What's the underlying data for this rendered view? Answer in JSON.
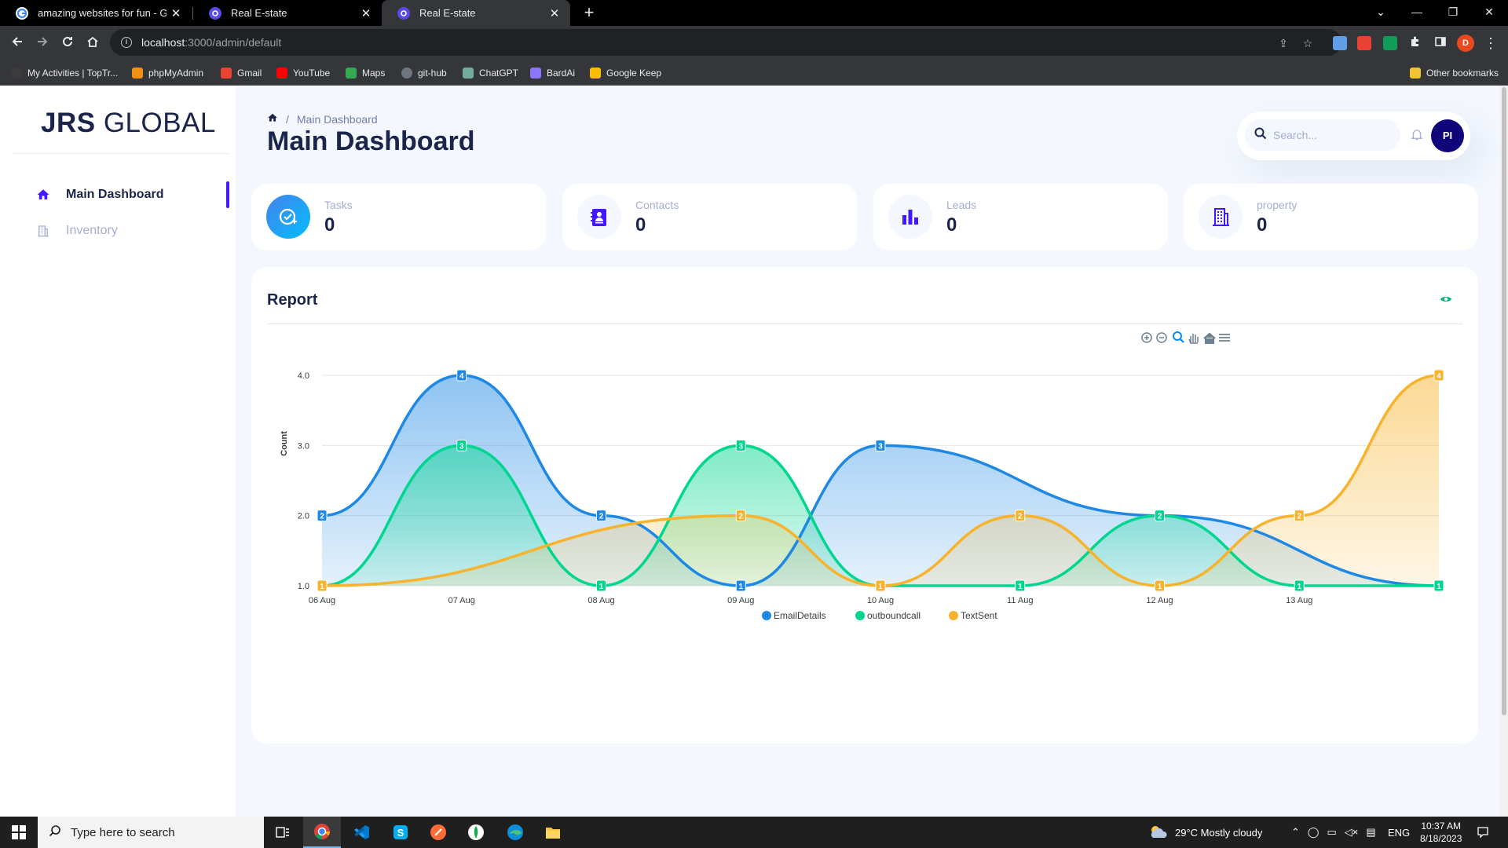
{
  "browser": {
    "tabs": [
      {
        "title": "amazing websites for fun - Goog",
        "favicon": "google-icon",
        "active": false
      },
      {
        "title": "Real E-state",
        "favicon": "app-icon",
        "active": false
      },
      {
        "title": "Real E-state",
        "favicon": "app-icon",
        "active": true
      }
    ],
    "url_host": "localhost",
    "url_path": ":3000/admin/default",
    "profile_initial": "D",
    "bookmarks": [
      {
        "label": "My Activities | TopTr...",
        "color": "#3c3c3c"
      },
      {
        "label": "phpMyAdmin",
        "color": "#f29111"
      },
      {
        "label": "Gmail",
        "color": "#ea4335"
      },
      {
        "label": "YouTube",
        "color": "#ff0000"
      },
      {
        "label": "Maps",
        "color": "#34a853"
      },
      {
        "label": "git-hub",
        "color": "#6e7681"
      },
      {
        "label": "ChatGPT",
        "color": "#74aa9c"
      },
      {
        "label": "BardAi",
        "color": "#8e75ff"
      },
      {
        "label": "Google Keep",
        "color": "#fbbc04"
      }
    ],
    "other_bookmarks": "Other bookmarks"
  },
  "sidebar": {
    "brand_bold": "JRS",
    "brand_rest": " GLOBAL",
    "items": [
      {
        "label": "Main Dashboard",
        "icon": "home-icon",
        "active": true
      },
      {
        "label": "Inventory",
        "icon": "building-icon",
        "active": false
      }
    ]
  },
  "header": {
    "breadcrumb": "Main Dashboard",
    "title": "Main Dashboard",
    "search_placeholder": "Search...",
    "avatar_initials": "PI"
  },
  "stats": [
    {
      "label": "Tasks",
      "value": "0",
      "icon": "task-check-icon"
    },
    {
      "label": "Contacts",
      "value": "0",
      "icon": "contact-book-icon"
    },
    {
      "label": "Leads",
      "value": "0",
      "icon": "bar-chart-icon"
    },
    {
      "label": "property",
      "value": "0",
      "icon": "building-icon"
    }
  ],
  "report": {
    "title": "Report"
  },
  "chart_data": {
    "type": "area",
    "categories": [
      "06 Aug",
      "07 Aug",
      "08 Aug",
      "09 Aug",
      "10 Aug",
      "11 Aug",
      "12 Aug",
      "13 Aug",
      ""
    ],
    "series": [
      {
        "name": "EmailDetails",
        "color": "#1e88e5",
        "values": [
          2,
          4,
          2,
          1,
          3,
          null,
          2,
          null,
          1
        ]
      },
      {
        "name": "outboundcall",
        "color": "#00d68f",
        "values": [
          1,
          3,
          1,
          3,
          1,
          1,
          2,
          1,
          1
        ]
      },
      {
        "name": "TextSent",
        "color": "#f7b32b",
        "values": [
          1,
          null,
          null,
          2,
          1,
          2,
          1,
          2,
          4
        ]
      }
    ],
    "ylabel": "Count",
    "yticks": [
      "1.0",
      "2.0",
      "3.0",
      "4.0"
    ],
    "ylim": [
      1,
      4
    ],
    "grid": true,
    "legend": "bottom-center"
  },
  "taskbar": {
    "search_placeholder": "Type here to search",
    "weather": "29°C  Mostly cloudy",
    "lang": "ENG",
    "time": "10:37 AM",
    "date": "8/18/2023"
  }
}
